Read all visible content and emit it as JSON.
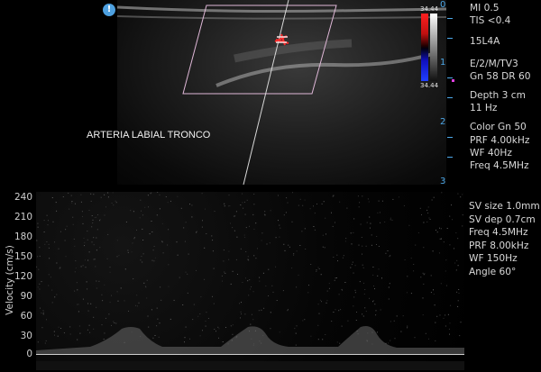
{
  "header": {
    "info_icon": "!"
  },
  "params_top": [
    "MI  0.5",
    "TIS <0.4",
    "15L4A",
    "E/2/M/TV3",
    "Gn 58  DR 60",
    "Depth 3 cm",
    "11 Hz",
    "Color  Gn 50",
    "PRF 4.00kHz",
    "WF 40Hz",
    "Freq 4.5MHz"
  ],
  "depth_ruler": [
    "0",
    "1",
    "2",
    "3"
  ],
  "color_scale": {
    "top": "34.44",
    "bottom": "34.44"
  },
  "vessel_label": "ARTERIA LABIAL TRONCO",
  "doppler": {
    "ylabel": "Velocity (cm/s)",
    "yticks": [
      "240",
      "210",
      "180",
      "150",
      "120",
      "90",
      "60",
      "30",
      "0"
    ],
    "ylim": [
      0,
      240
    ],
    "params": [
      "SV size 1.0mm",
      "SV dep 0.7cm",
      "Freq 4.5MHz",
      "PRF 8.00kHz",
      "WF 150Hz",
      "Angle 60°"
    ]
  },
  "colors": {
    "ruler": "#4da8e8",
    "text": "#d8d8d8",
    "background": "#000000"
  }
}
